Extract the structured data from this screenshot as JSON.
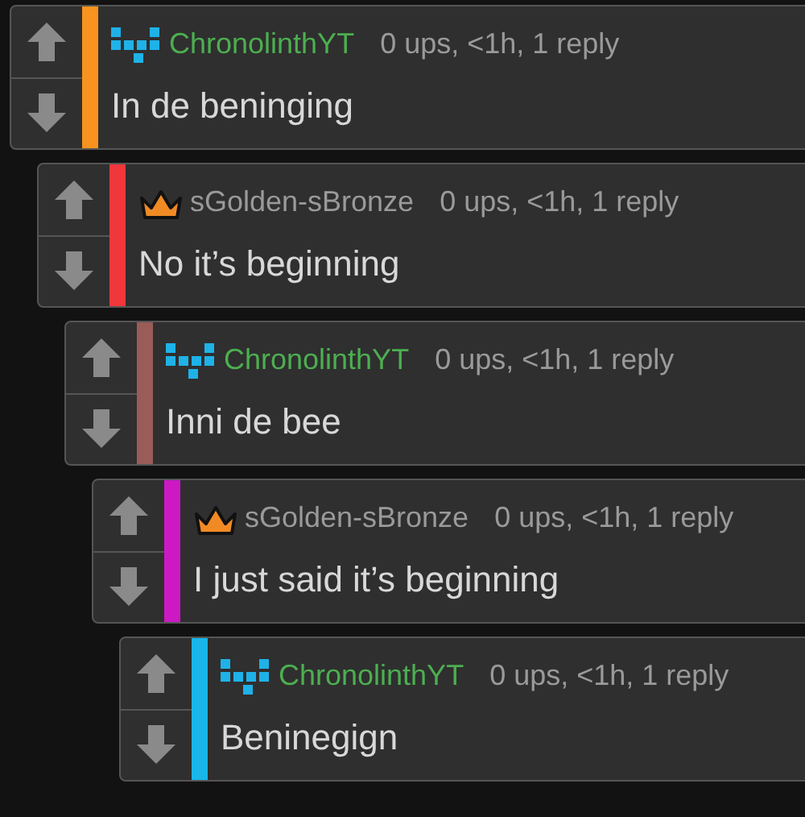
{
  "comments": [
    {
      "author": "ChronolinthYT",
      "kind": "pixels",
      "color": "#f7931e",
      "meta": "0 ups, <1h, 1 reply",
      "text": "In de beninging",
      "children": [
        {
          "author": "sGolden-sBronze",
          "kind": "crown",
          "color": "#f0373c",
          "meta": "0 ups, <1h, 1 reply",
          "text": "No it’s beginning",
          "children": [
            {
              "author": "ChronolinthYT",
              "kind": "pixels",
              "color": "#9a5c58",
              "meta": "0 ups, <1h, 1 reply",
              "text": "Inni de bee",
              "children": [
                {
                  "author": "sGolden-sBronze",
                  "kind": "crown",
                  "color": "#cc19c4",
                  "meta": "0 ups, <1h, 1 reply",
                  "text": "I just said it’s beginning",
                  "children": [
                    {
                      "author": "ChronolinthYT",
                      "kind": "pixels",
                      "color": "#19b6ea",
                      "meta": "0 ups, <1h, 1 reply",
                      "text": "Beninegign"
                    }
                  ]
                }
              ]
            }
          ]
        }
      ]
    }
  ]
}
